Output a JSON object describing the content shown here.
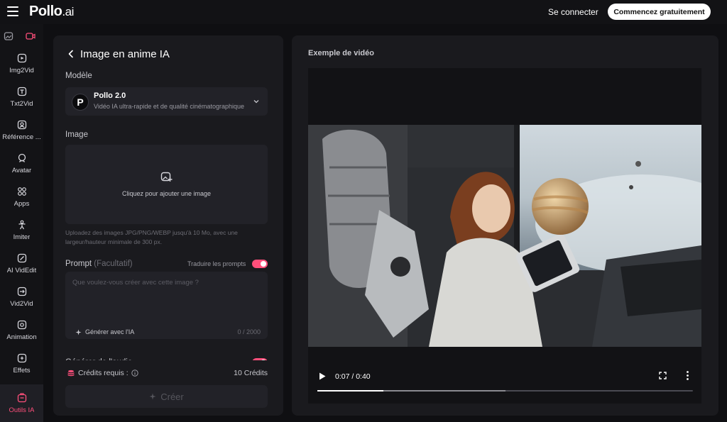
{
  "header": {
    "logo_main": "Pollo",
    "logo_suffix": ".ai",
    "signin_label": "Se connecter",
    "cta_label": "Commencez gratuitement"
  },
  "rail": {
    "items": [
      {
        "label": "Img2Vid",
        "icon": "image-to-video-icon"
      },
      {
        "label": "Txt2Vid",
        "icon": "text-to-video-icon"
      },
      {
        "label": "Référence ...",
        "icon": "reference-icon"
      },
      {
        "label": "Avatar",
        "icon": "avatar-icon"
      },
      {
        "label": "Apps",
        "icon": "apps-icon"
      },
      {
        "label": "Imiter",
        "icon": "imitate-icon"
      },
      {
        "label": "AI VidEdit",
        "icon": "video-edit-icon"
      },
      {
        "label": "Vid2Vid",
        "icon": "video-to-video-icon"
      },
      {
        "label": "Animation",
        "icon": "animation-icon"
      },
      {
        "label": "Effets",
        "icon": "effects-icon"
      },
      {
        "label": "Outils IA",
        "icon": "ai-tools-icon"
      }
    ],
    "active_index": 10,
    "accent": "#ff4f7b"
  },
  "panel": {
    "title": "Image en anime IA",
    "model_label": "Modèle",
    "model_name": "Pollo 2.0",
    "model_desc": "Vidéo IA ultra-rapide et de qualité cinématographique",
    "image_label": "Image",
    "upload_text": "Cliquez pour ajouter une image",
    "hint": "Uploadez des images JPG/PNG/WEBP jusqu'à 10 Mo, avec une largeur/hauteur minimale de 300 px.",
    "prompt_label": "Prompt",
    "prompt_optional": "(Facultatif)",
    "translate_label": "Traduire les prompts",
    "prompt_placeholder": "Que voulez-vous créer avec cette image ?",
    "generate_label": "Générer avec l'IA",
    "char_count": "0 / 2000",
    "audio_label": "Générer de l'audio",
    "credits_label": "Crédits requis :",
    "credits_value": "10 Crédits",
    "create_label": "Créer"
  },
  "preview": {
    "title": "Exemple de vidéo",
    "time": "0:07 / 0:40",
    "played_fraction": 0.175,
    "buffered_fraction": 0.5
  }
}
